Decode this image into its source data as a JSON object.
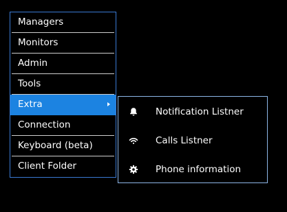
{
  "menu": {
    "items": [
      {
        "label": "Managers"
      },
      {
        "label": "Monitors"
      },
      {
        "label": "Admin"
      },
      {
        "label": "Tools"
      },
      {
        "label": "Extra",
        "active": true,
        "has_submenu": true
      },
      {
        "label": "Connection"
      },
      {
        "label": "Keyboard (beta)"
      },
      {
        "label": "Client Folder"
      }
    ]
  },
  "submenu": {
    "items": [
      {
        "label": "Notification Listner",
        "icon": "bell-icon"
      },
      {
        "label": "Calls Listner",
        "icon": "wifi-icon"
      },
      {
        "label": "Phone information",
        "icon": "gear-icon"
      }
    ]
  },
  "colors": {
    "background": "#000000",
    "menu_border": "#3a7bd5",
    "active_bg": "#1c83e1",
    "submenu_border": "#8fb9ea",
    "text": "#ffffff"
  }
}
